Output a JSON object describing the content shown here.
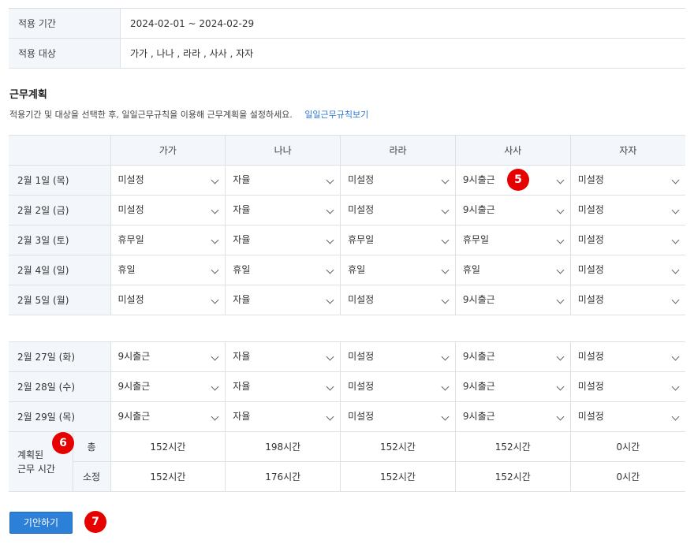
{
  "info": {
    "period_label": "적용 기간",
    "period_value": "2024-02-01 ~ 2024-02-29",
    "target_label": "적용 대상",
    "target_value": "가가 , 나나 , 라라 , 사사 , 자자"
  },
  "section": {
    "title": "근무계획",
    "description": "적용기간 및 대상을 선택한 후, 일일근무규칙을 이용해 근무계획을 설정하세요.",
    "link": "일일근무규칙보기"
  },
  "columns": [
    "가가",
    "나나",
    "라라",
    "사사",
    "자자"
  ],
  "rows_top": [
    {
      "date": "2월 1일 (목)",
      "values": [
        "미설정",
        "자율",
        "미설정",
        "9시출근",
        "미설정"
      ]
    },
    {
      "date": "2월 2일 (금)",
      "values": [
        "미설정",
        "자율",
        "미설정",
        "9시출근",
        "미설정"
      ]
    },
    {
      "date": "2월 3일 (토)",
      "values": [
        "휴무일",
        "자율",
        "휴무일",
        "휴무일",
        "미설정"
      ]
    },
    {
      "date": "2월 4일 (일)",
      "values": [
        "휴일",
        "휴일",
        "휴일",
        "휴일",
        "미설정"
      ]
    },
    {
      "date": "2월 5일 (월)",
      "values": [
        "미설정",
        "자율",
        "미설정",
        "9시출근",
        "미설정"
      ]
    }
  ],
  "rows_bottom": [
    {
      "date": "2월 27일 (화)",
      "values": [
        "9시출근",
        "자율",
        "미설정",
        "9시출근",
        "미설정"
      ]
    },
    {
      "date": "2월 28일 (수)",
      "values": [
        "9시출근",
        "자율",
        "미설정",
        "9시출근",
        "미설정"
      ]
    },
    {
      "date": "2월 29일 (목)",
      "values": [
        "9시출근",
        "자율",
        "미설정",
        "9시출근",
        "미설정"
      ]
    }
  ],
  "summary": {
    "label_line1": "계획된",
    "label_line2": "근무 시간",
    "total_label": "총",
    "total": [
      "152시간",
      "198시간",
      "152시간",
      "152시간",
      "0시간"
    ],
    "regular_label": "소정",
    "regular": [
      "152시간",
      "176시간",
      "152시간",
      "152시간",
      "0시간"
    ]
  },
  "badges": {
    "b5": "5",
    "b6": "6",
    "b7": "7"
  },
  "button": {
    "submit": "기안하기"
  },
  "colors": {
    "accent": "#2d80d8",
    "badge": "#e60000",
    "header_bg": "#f3f6fb",
    "link": "#2e77d0"
  }
}
